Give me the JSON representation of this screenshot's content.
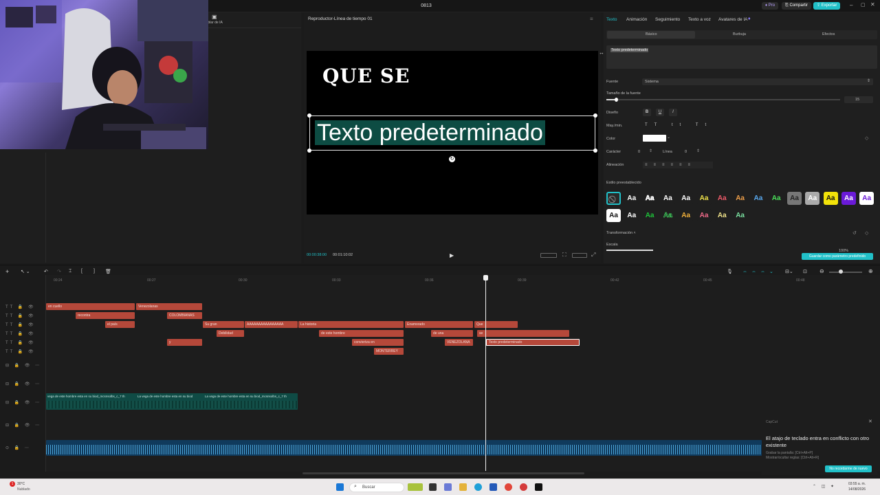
{
  "window": {
    "title": "0813",
    "pro_label": "Pro",
    "share_label": "Compartir",
    "export_label": "Exportar"
  },
  "media": {
    "ai_label": "Doblar de IA"
  },
  "player": {
    "title": "Reproductor-Línea de tiempo 01",
    "current_time": "00:00:38:00",
    "total_time": "00:01:10:02",
    "line1": "QUE SE",
    "line2": "Texto predeterminado"
  },
  "panel": {
    "tabs": [
      "Texto",
      "Animación",
      "Seguimiento",
      "Texto a voz",
      "Avatares de IA"
    ],
    "subtabs": [
      "Básico",
      "Burbuja",
      "Efectos"
    ],
    "text_value": "Texto predeterminado",
    "font_label": "Fuente",
    "font_value": "Sistema",
    "font_size_label": "Tamaño de la fuente",
    "font_size_value": "15",
    "design_label": "Diseño",
    "case_label": "May./min.",
    "color_label": "Color",
    "char_label": "Carácter",
    "char_value": "0",
    "line_label": "Línea",
    "line_value": "0",
    "align_label": "Alineación",
    "preset_label": "Estilo preestablecido",
    "preset_text": "Aa",
    "transform_label": "Transformación",
    "scale_label": "Escala",
    "scale_value": "100%",
    "save_preset": "Guardar como parámetro predefinido",
    "accent": "#21c0c8"
  },
  "timeline": {
    "ticks": [
      "00:24",
      "00:27",
      "00:30",
      "00:33",
      "00:36",
      "00:39",
      "00:42",
      "00:45",
      "00:48"
    ],
    "clips": [
      {
        "t": "en cuello"
      },
      {
        "t": "Venezolanas"
      },
      {
        "t": "recontra"
      },
      {
        "t": "COLOMBIANAS"
      },
      {
        "t": "el país"
      },
      {
        "t": "Su gran"
      },
      {
        "t": "AAAAAAAAAAAAAAAA"
      },
      {
        "t": "La historia"
      },
      {
        "t": "Enamorado"
      },
      {
        "t": "Que"
      },
      {
        "t": "Debilidad"
      },
      {
        "t": "de este hombre"
      },
      {
        "t": "de una"
      },
      {
        "t": "se"
      },
      {
        "t": "y"
      },
      {
        "t": "conviertza en"
      },
      {
        "t": "VENEZOLANA"
      },
      {
        "t": "Texto predeterminado"
      },
      {
        "t": "MONTERREY"
      }
    ],
    "video_clips": [
      "vega de este hombre esta en su biod_mcsnsolbs_c_7 th",
      "La vega de este hombre esta en su biod",
      "La vega de este hombre esta en su biod_mcsnsolbs_c_7 th"
    ]
  },
  "toast": {
    "app": "CapCut",
    "title": "El atajo de teclado entra en conflicto con otro existente",
    "line1": "Grabar la pantalla: [Ctrl+Alt+P]",
    "line2": "Mostrar/ocultar reglas: [Ctrl+Alt+R]",
    "button": "No recordarme de nuevo"
  },
  "taskbar": {
    "temp": "30°C",
    "weather": "Nublado",
    "search": "Buscar",
    "time": "03:55 a. m.",
    "date": "14/08/2026",
    "badge": "1"
  }
}
